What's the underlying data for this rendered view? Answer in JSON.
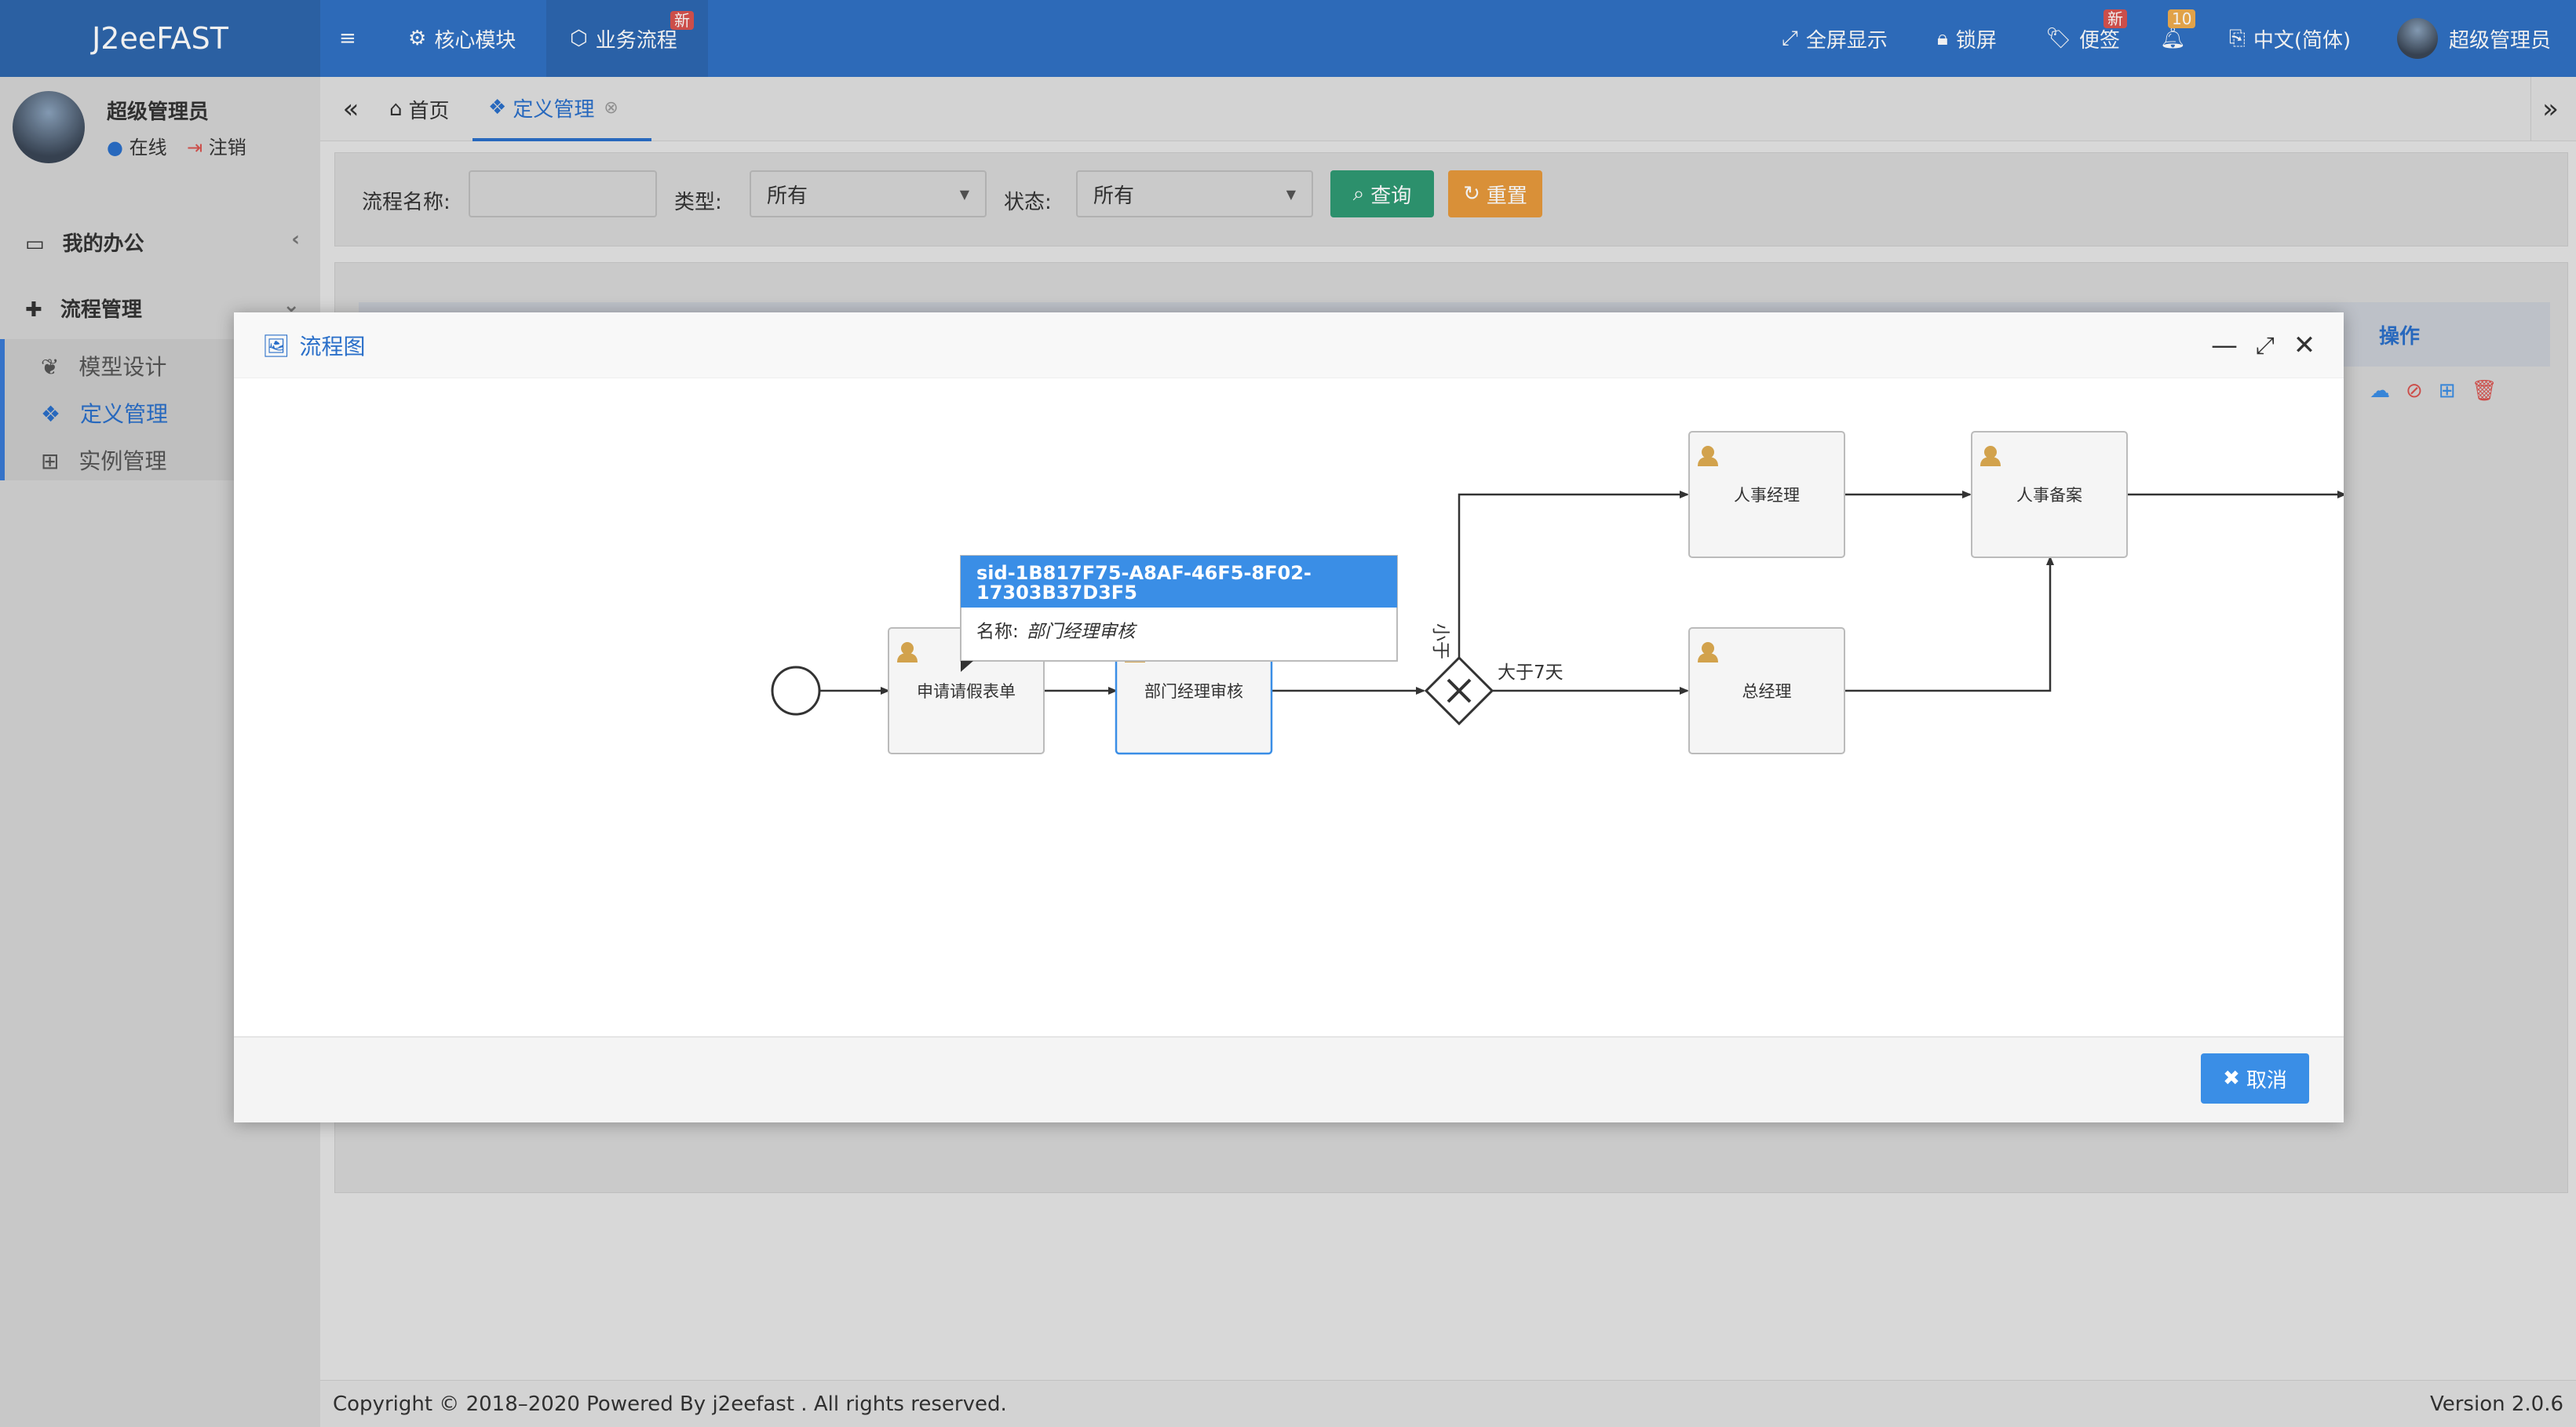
{
  "header": {
    "logo": "J2eeFAST",
    "menu_icon": "bars-icon",
    "nav": [
      {
        "label": "核心模块",
        "icon": "gear-icon"
      },
      {
        "label": "业务流程",
        "icon": "cube-icon",
        "badge": "新"
      }
    ],
    "right": {
      "fullscreen": "全屏显示",
      "lock": "锁屏",
      "note": "便签",
      "note_badge": "新",
      "bell_badge": "10",
      "language": "中文(简体)",
      "user": "超级管理员"
    }
  },
  "sidebar": {
    "user_name": "超级管理员",
    "status_online": "在线",
    "logout": "注销",
    "menu": [
      {
        "label": "我的办公",
        "icon": "laptop-icon"
      },
      {
        "label": "流程管理",
        "icon": "puzzle-icon"
      }
    ],
    "submenu": [
      {
        "label": "模型设计",
        "icon": "leaf-icon"
      },
      {
        "label": "定义管理",
        "icon": "cubes-icon"
      },
      {
        "label": "实例管理",
        "icon": "sitemap-icon"
      }
    ]
  },
  "tabs": {
    "home": "首页",
    "active": "定义管理"
  },
  "search": {
    "name_label": "流程名称:",
    "name_value": "",
    "type_label": "类型:",
    "type_value": "所有",
    "status_label": "状态:",
    "status_value": "所有",
    "query_btn": "查询",
    "reset_btn": "重置"
  },
  "table": {
    "ops_header": "操作"
  },
  "modal": {
    "title": "流程图",
    "cancel_btn": "取消",
    "tooltip": {
      "id_line1": "sid-1B817F75-A8AF-46F5-8F02-",
      "id_line2": "17303B37D3F5",
      "name_label": "名称:",
      "name_value": "部门经理审核"
    },
    "diagram": {
      "nodes": {
        "apply": "申请请假表单",
        "dept": "部门经理审核",
        "hr_manager": "人事经理",
        "hr_record": "人事备案",
        "gm": "总经理"
      },
      "edges": {
        "gt7": "大于7天",
        "lt": "小于"
      }
    }
  },
  "footer": {
    "copyright": "Copyright © 2018–2020 Powered By j2eefast . All rights reserved.",
    "version": "Version 2.0.6"
  },
  "colors": {
    "topbar": "#3071c4",
    "accent": "#2a6fc9",
    "query": "#2f9a73",
    "reset": "#e79a3c",
    "danger": "#d9534f"
  }
}
